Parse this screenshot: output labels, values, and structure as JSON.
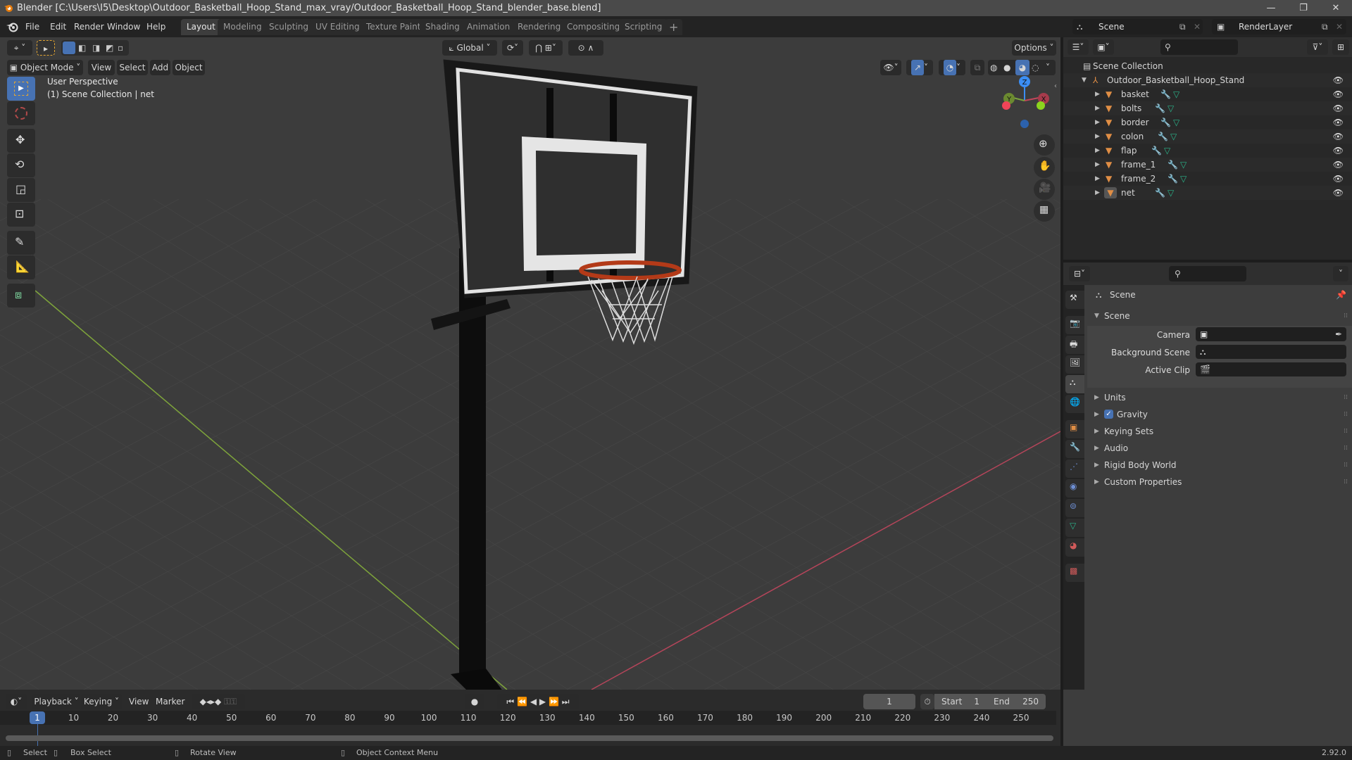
{
  "window": {
    "title": "Blender [C:\\Users\\I5\\Desktop\\Outdoor_Basketball_Hoop_Stand_max_vray/Outdoor_Basketball_Hoop_Stand_blender_base.blend]",
    "controls": [
      "minimize",
      "maximize",
      "close"
    ]
  },
  "menubar": {
    "menus": [
      "File",
      "Edit",
      "Render",
      "Window",
      "Help"
    ],
    "workspaces": [
      {
        "label": "Layout",
        "active": true
      },
      {
        "label": "Modeling",
        "active": false
      },
      {
        "label": "Sculpting",
        "active": false
      },
      {
        "label": "UV Editing",
        "active": false
      },
      {
        "label": "Texture Paint",
        "active": false
      },
      {
        "label": "Shading",
        "active": false
      },
      {
        "label": "Animation",
        "active": false
      },
      {
        "label": "Rendering",
        "active": false
      },
      {
        "label": "Compositing",
        "active": false
      },
      {
        "label": "Scripting",
        "active": false
      }
    ],
    "add_workspace": "+",
    "scene": "Scene",
    "view_layer": "RenderLayer"
  },
  "viewport": {
    "transform_orientation": "Global",
    "options_label": "Options",
    "mode": "Object Mode",
    "menus": [
      "View",
      "Select",
      "Add",
      "Object"
    ],
    "overlay_title": "User Perspective",
    "overlay_subtitle": "(1) Scene Collection | net",
    "gizmo_axes": {
      "x": "X",
      "y": "Y",
      "z": "Z"
    },
    "colors": {
      "x_axis": "#c2465a",
      "y_axis": "#7aa43c",
      "z_axis": "#3b8ef5",
      "active_tool": "#4772b3"
    },
    "tools": [
      "select-box",
      "cursor",
      "move",
      "rotate",
      "scale",
      "transform",
      "annotate",
      "measure",
      "add-cube"
    ],
    "nav_buttons": [
      "zoom",
      "pan",
      "camera",
      "perspective-toggle"
    ]
  },
  "outliner": {
    "root": "Scene Collection",
    "collection": "Outdoor_Basketball_Hoop_Stand",
    "objects": [
      "basket",
      "bolts",
      "border",
      "colon",
      "flap",
      "frame_1",
      "frame_2",
      "net"
    ],
    "active_object": "net"
  },
  "properties": {
    "context": "Scene",
    "panel_title": "Scene",
    "fields": [
      {
        "label": "Camera",
        "value": ""
      },
      {
        "label": "Background Scene",
        "value": ""
      },
      {
        "label": "Active Clip",
        "value": ""
      }
    ],
    "subpanels": [
      {
        "label": "Units",
        "checkbox": false
      },
      {
        "label": "Gravity",
        "checkbox": true,
        "checked": true
      },
      {
        "label": "Keying Sets",
        "checkbox": false
      },
      {
        "label": "Audio",
        "checkbox": false
      },
      {
        "label": "Rigid Body World",
        "checkbox": false
      },
      {
        "label": "Custom Properties",
        "checkbox": false
      }
    ],
    "tabs": [
      "tool",
      "render",
      "output",
      "view-layer",
      "scene",
      "world",
      "object",
      "modifiers",
      "particles",
      "physics",
      "constraints",
      "data",
      "material",
      "texture"
    ],
    "active_tab": "scene"
  },
  "timeline": {
    "menus": [
      "Playback",
      "Keying",
      "View",
      "Marker"
    ],
    "current_frame": "1",
    "start_label": "Start",
    "start": "1",
    "end_label": "End",
    "end": "250",
    "ticks": [
      "10",
      "20",
      "30",
      "40",
      "50",
      "60",
      "70",
      "80",
      "90",
      "100",
      "110",
      "120",
      "130",
      "140",
      "150",
      "160",
      "170",
      "180",
      "190",
      "200",
      "210",
      "220",
      "230",
      "240",
      "250"
    ],
    "playhead": "1"
  },
  "statusbar": {
    "hints": [
      "Select",
      "Box Select",
      "Rotate View",
      "Object Context Menu"
    ],
    "version": "2.92.0"
  }
}
